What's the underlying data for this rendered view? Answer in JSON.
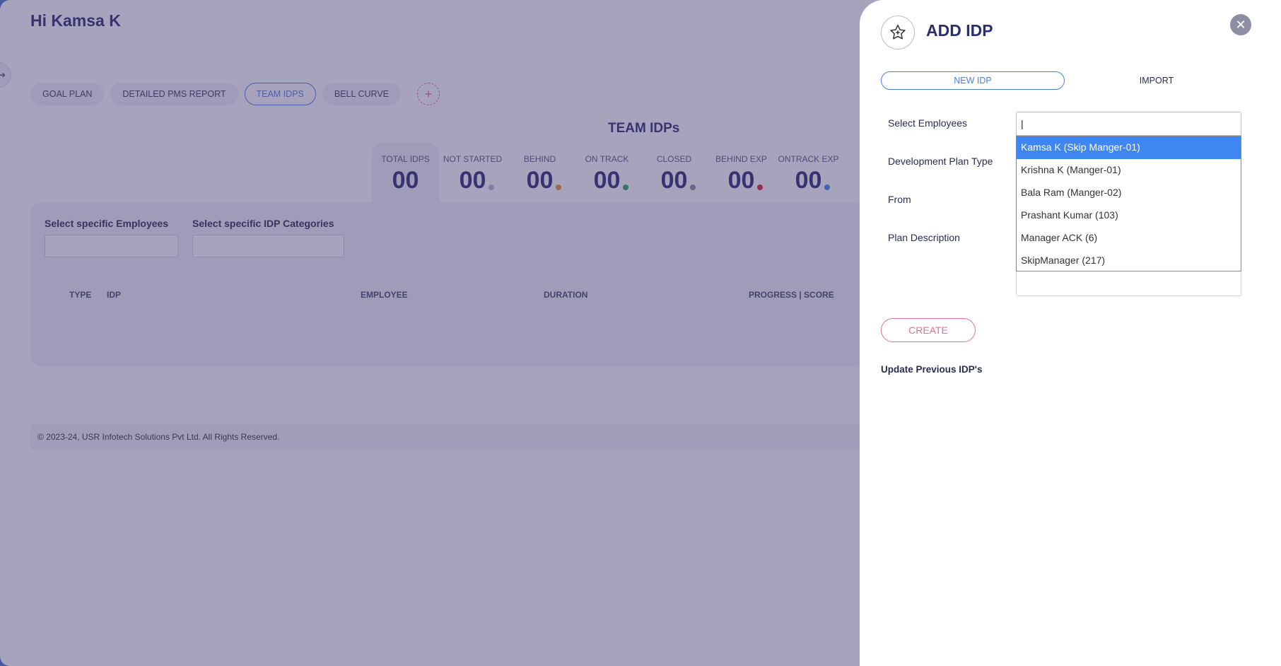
{
  "greeting": "Hi Kamsa K",
  "tabs": [
    {
      "label": "GOAL PLAN"
    },
    {
      "label": "DETAILED PMS REPORT"
    },
    {
      "label": "TEAM IDPS",
      "active": true
    },
    {
      "label": "BELL CURVE"
    }
  ],
  "tab_add_icon": "plus-icon",
  "team": {
    "title": "TEAM IDPs",
    "stats": [
      {
        "label": "TOTAL IDPS",
        "value": "00",
        "dot": ""
      },
      {
        "label": "NOT STARTED",
        "value": "00",
        "dot": "#b6b8c4"
      },
      {
        "label": "BEHIND",
        "value": "00",
        "dot": "#e6932a"
      },
      {
        "label": "ON TRACK",
        "value": "00",
        "dot": "#23a559"
      },
      {
        "label": "CLOSED",
        "value": "00",
        "dot": "#8b8d98"
      },
      {
        "label": "BEHIND EXP",
        "value": "00",
        "dot": "#d9232d"
      },
      {
        "label": "ONTRACK EXP",
        "value": "00",
        "dot": "#3f86f0"
      }
    ]
  },
  "filters": {
    "employees_label": "Select specific Employees",
    "categories_label": "Select specific IDP Categories"
  },
  "table": {
    "columns": [
      "TYPE",
      "IDP",
      "EMPLOYEE",
      "DURATION",
      "PROGRESS | SCORE"
    ]
  },
  "footer": "© 2023-24, USR Infotech Solutions Pvt Ltd. All Rights Reserved.",
  "drawer": {
    "title": "ADD IDP",
    "icon": "star-badge-icon",
    "tabs": [
      {
        "label": "NEW IDP",
        "active": true
      },
      {
        "label": "IMPORT"
      }
    ],
    "fields": {
      "employees_label": "Select Employees",
      "plan_type_label": "Development Plan Type",
      "from_label": "From",
      "description_label": "Plan Description"
    },
    "employee_input_value": "|",
    "dropdown_options": [
      {
        "label": "Kamsa K (Skip Manger-01)",
        "selected": true
      },
      {
        "label": "Krishna K (Manger-01)"
      },
      {
        "label": "Bala Ram (Manger-02)"
      },
      {
        "label": "Prashant Kumar (103)"
      },
      {
        "label": "Manager ACK (6)"
      },
      {
        "label": "SkipManager (217)"
      }
    ],
    "create_label": "CREATE",
    "update_link": "Update Previous IDP's"
  },
  "colors": {
    "accent": "#4a7ee0",
    "title": "#2a2d6e",
    "create": "#e07090",
    "selected_option": "#3f86f0"
  }
}
